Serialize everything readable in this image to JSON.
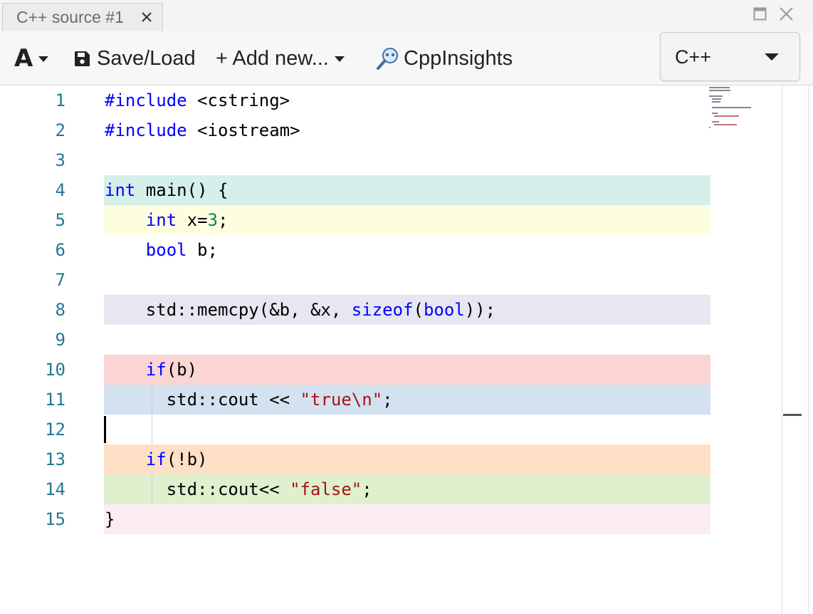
{
  "tab": {
    "title": "C++ source #1"
  },
  "toolbar": {
    "font_label": "A",
    "save_load_label": "Save/Load",
    "add_new_label": "+ Add new...",
    "cppinsights_label": "CppInsights",
    "language": "C++"
  },
  "editor": {
    "cursor_line": 12,
    "lines": [
      {
        "n": "1",
        "bg": "",
        "tokens": [
          [
            "pp",
            "#include"
          ],
          [
            "t",
            " <cstring>"
          ]
        ]
      },
      {
        "n": "2",
        "bg": "",
        "tokens": [
          [
            "pp",
            "#include"
          ],
          [
            "t",
            " <iostream>"
          ]
        ]
      },
      {
        "n": "3",
        "bg": "",
        "tokens": []
      },
      {
        "n": "4",
        "bg": "#d5efea",
        "tokens": [
          [
            "kw",
            "int"
          ],
          [
            "t",
            " main() {"
          ]
        ]
      },
      {
        "n": "5",
        "bg": "#fdfde0",
        "tokens": [
          [
            "t",
            "    "
          ],
          [
            "kw",
            "int"
          ],
          [
            "t",
            " x="
          ],
          [
            "num",
            "3"
          ],
          [
            "t",
            ";"
          ]
        ]
      },
      {
        "n": "6",
        "bg": "",
        "tokens": [
          [
            "t",
            "    "
          ],
          [
            "kw",
            "bool"
          ],
          [
            "t",
            " b;"
          ]
        ]
      },
      {
        "n": "7",
        "bg": "",
        "tokens": []
      },
      {
        "n": "8",
        "bg": "#e7e7f2",
        "tokens": [
          [
            "t",
            "    std::memcpy(&b, &x, "
          ],
          [
            "kw",
            "sizeof"
          ],
          [
            "t",
            "("
          ],
          [
            "kw",
            "bool"
          ],
          [
            "t",
            "));"
          ]
        ]
      },
      {
        "n": "9",
        "bg": "",
        "tokens": []
      },
      {
        "n": "10",
        "bg": "#fbd4d4",
        "tokens": [
          [
            "t",
            "    "
          ],
          [
            "kw",
            "if"
          ],
          [
            "t",
            "(b)"
          ]
        ]
      },
      {
        "n": "11",
        "bg": "#d3e2f1",
        "tokens": [
          [
            "t",
            "      std::cout << "
          ],
          [
            "str",
            "\"true\\n\""
          ],
          [
            "t",
            ";"
          ]
        ]
      },
      {
        "n": "12",
        "bg": "",
        "tokens": []
      },
      {
        "n": "13",
        "bg": "#fde0c5",
        "tokens": [
          [
            "t",
            "    "
          ],
          [
            "kw",
            "if"
          ],
          [
            "t",
            "(!b)"
          ]
        ]
      },
      {
        "n": "14",
        "bg": "#dff0cf",
        "tokens": [
          [
            "t",
            "      std::cout<< "
          ],
          [
            "str",
            "\"false\""
          ],
          [
            "t",
            ";"
          ]
        ]
      },
      {
        "n": "15",
        "bg": "#fcecf4",
        "tokens": [
          [
            "t",
            "}"
          ]
        ]
      }
    ]
  },
  "colors": {
    "keyword": "#0000ff",
    "number": "#098658",
    "string": "#a31515",
    "line_number": "#237893"
  },
  "icons": {
    "tab_close": "close-icon",
    "maximize": "maximize-icon",
    "window_close": "close-icon",
    "save": "floppy-disk-icon",
    "add": "plus-icon",
    "insights": "magnifier-icon",
    "dropdown": "chevron-down-icon"
  }
}
